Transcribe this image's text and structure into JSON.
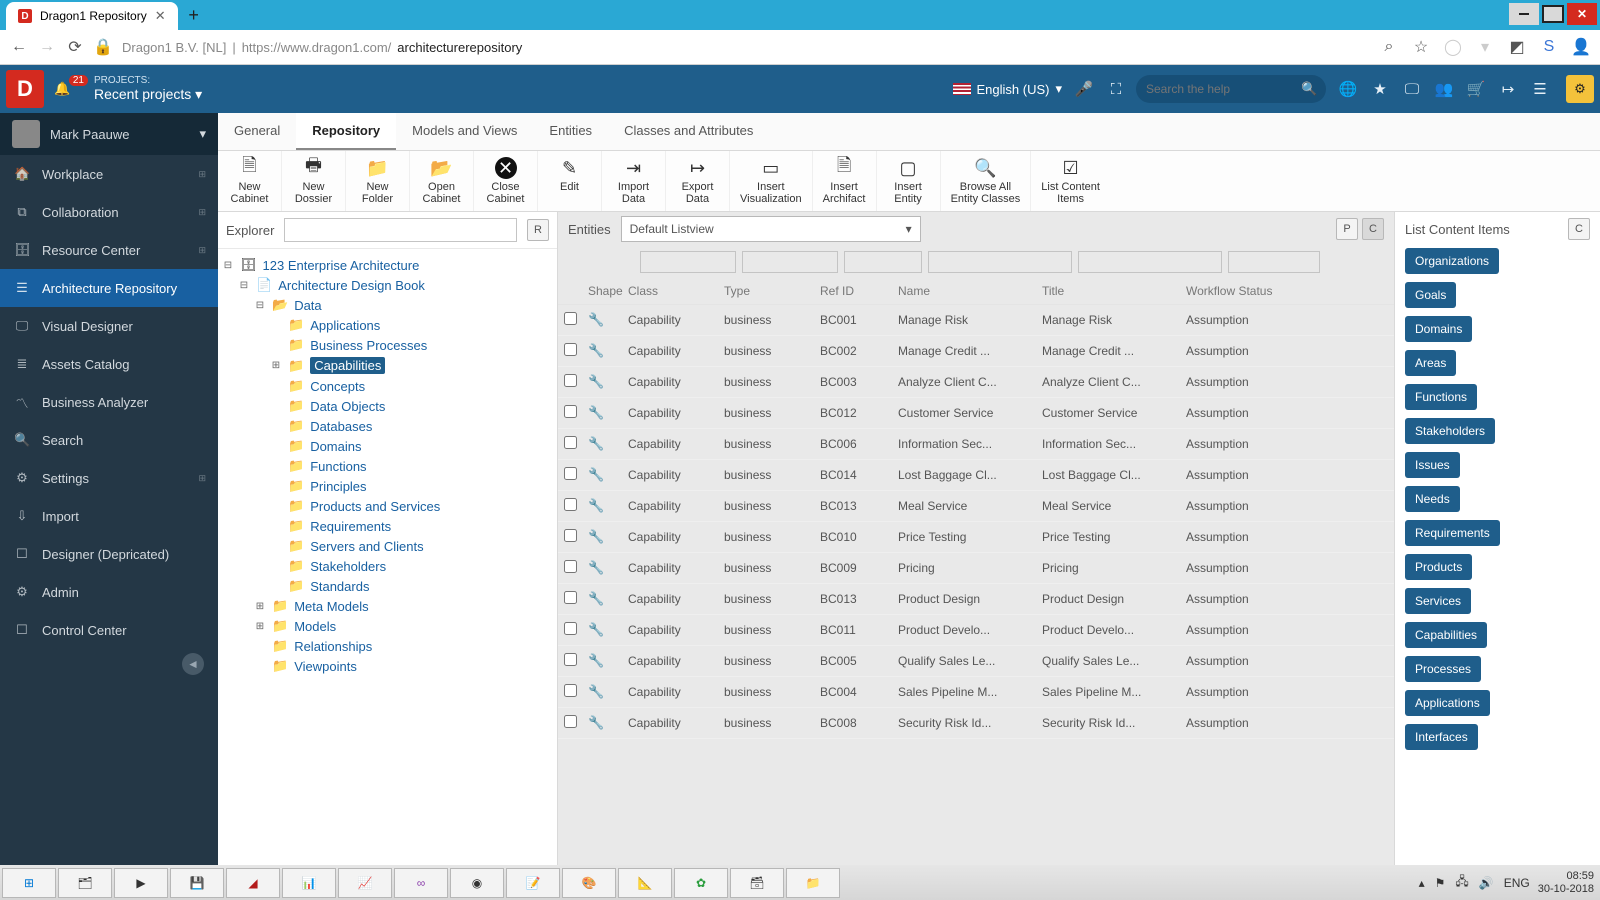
{
  "browser": {
    "tab_title": "Dragon1 Repository",
    "identity": "Dragon1 B.V. [NL]",
    "url_host": "https://www.dragon1.com/",
    "url_path": "architecturerepository"
  },
  "header": {
    "projects_label": "PROJECTS:",
    "projects_name": "Recent projects",
    "badge": "21",
    "language": "English (US)",
    "search_placeholder": "Search the help"
  },
  "user": {
    "name": "Mark Paauwe"
  },
  "leftnav": {
    "items": [
      {
        "label": "Workplace",
        "icon": "🏠",
        "plus": true
      },
      {
        "label": "Collaboration",
        "icon": "⧉",
        "plus": true
      },
      {
        "label": "Resource Center",
        "icon": "🗄",
        "plus": true
      },
      {
        "label": "Architecture Repository",
        "icon": "☰",
        "active": true
      },
      {
        "label": "Visual Designer",
        "icon": "🖵"
      },
      {
        "label": "Assets Catalog",
        "icon": "≣"
      },
      {
        "label": "Business Analyzer",
        "icon": "〽"
      },
      {
        "label": "Search",
        "icon": "🔍"
      },
      {
        "label": "Settings",
        "icon": "⚙",
        "plus": true
      },
      {
        "label": "Import",
        "icon": "⇩"
      },
      {
        "label": "Designer (Depricated)",
        "icon": "☐"
      },
      {
        "label": "Admin",
        "icon": "⚙"
      },
      {
        "label": "Control Center",
        "icon": "☐"
      }
    ]
  },
  "tabs": [
    "General",
    "Repository",
    "Models and Views",
    "Entities",
    "Classes and Attributes"
  ],
  "ribbon": [
    {
      "label": "New Cabinet",
      "icon": "🗎"
    },
    {
      "label": "New Dossier",
      "icon": "🖶"
    },
    {
      "label": "New Folder",
      "icon": "📁"
    },
    {
      "label": "Open Cabinet",
      "icon": "📂"
    },
    {
      "label": "Close Cabinet",
      "icon": "✕",
      "black": true
    },
    {
      "label": "Edit",
      "icon": "✎"
    },
    {
      "label": "Import Data",
      "icon": "⇥"
    },
    {
      "label": "Export Data",
      "icon": "↦"
    },
    {
      "label": "Insert Visualization",
      "icon": "▭"
    },
    {
      "label": "Insert Archifact",
      "icon": "🗎"
    },
    {
      "label": "Insert Entity",
      "icon": "▢"
    },
    {
      "label": "Browse All Entity Classes",
      "icon": "🔍"
    },
    {
      "label": "List Content Items",
      "icon": "☑"
    }
  ],
  "explorer": {
    "title": "Explorer"
  },
  "tree": {
    "root": "123 Enterprise Architecture",
    "book": "Architecture Design Book",
    "data": "Data",
    "data_children": [
      "Applications",
      "Business Processes",
      "Capabilities",
      "Concepts",
      "Data Objects",
      "Databases",
      "Domains",
      "Functions",
      "Principles",
      "Products and Services",
      "Requirements",
      "Servers and Clients",
      "Stakeholders",
      "Standards"
    ],
    "siblings": [
      "Meta Models",
      "Models",
      "Relationships",
      "Viewpoints"
    ]
  },
  "entities": {
    "title": "Entities",
    "listview": "Default Listview",
    "cols": [
      "Shape",
      "Class",
      "Type",
      "Ref ID",
      "Name",
      "Title",
      "Workflow Status"
    ],
    "rows": [
      {
        "class": "Capability",
        "type": "business",
        "ref": "BC001",
        "name": "Manage Risk",
        "title": "Manage Risk",
        "wf": "Assumption"
      },
      {
        "class": "Capability",
        "type": "business",
        "ref": "BC002",
        "name": "Manage Credit ...",
        "title": "Manage Credit ...",
        "wf": "Assumption"
      },
      {
        "class": "Capability",
        "type": "business",
        "ref": "BC003",
        "name": "Analyze Client C...",
        "title": "Analyze Client C...",
        "wf": "Assumption"
      },
      {
        "class": "Capability",
        "type": "business",
        "ref": "BC012",
        "name": "Customer Service",
        "title": "Customer Service",
        "wf": "Assumption"
      },
      {
        "class": "Capability",
        "type": "business",
        "ref": "BC006",
        "name": "Information Sec...",
        "title": "Information Sec...",
        "wf": "Assumption"
      },
      {
        "class": "Capability",
        "type": "business",
        "ref": "BC014",
        "name": "Lost Baggage Cl...",
        "title": "Lost Baggage Cl...",
        "wf": "Assumption"
      },
      {
        "class": "Capability",
        "type": "business",
        "ref": "BC013",
        "name": "Meal Service",
        "title": "Meal Service",
        "wf": "Assumption"
      },
      {
        "class": "Capability",
        "type": "business",
        "ref": "BC010",
        "name": "Price Testing",
        "title": "Price Testing",
        "wf": "Assumption"
      },
      {
        "class": "Capability",
        "type": "business",
        "ref": "BC009",
        "name": "Pricing",
        "title": "Pricing",
        "wf": "Assumption"
      },
      {
        "class": "Capability",
        "type": "business",
        "ref": "BC013",
        "name": "Product Design",
        "title": "Product Design",
        "wf": "Assumption"
      },
      {
        "class": "Capability",
        "type": "business",
        "ref": "BC011",
        "name": "Product Develo...",
        "title": "Product Develo...",
        "wf": "Assumption"
      },
      {
        "class": "Capability",
        "type": "business",
        "ref": "BC005",
        "name": "Qualify Sales Le...",
        "title": "Qualify Sales Le...",
        "wf": "Assumption"
      },
      {
        "class": "Capability",
        "type": "business",
        "ref": "BC004",
        "name": "Sales Pipeline M...",
        "title": "Sales Pipeline M...",
        "wf": "Assumption"
      },
      {
        "class": "Capability",
        "type": "business",
        "ref": "BC008",
        "name": "Security Risk Id...",
        "title": "Security Risk Id...",
        "wf": "Assumption"
      }
    ]
  },
  "right": {
    "title": "List Content Items",
    "chips": [
      "Organizations",
      "Goals",
      "Domains",
      "Areas",
      "Functions",
      "Stakeholders",
      "Issues",
      "Needs",
      "Requirements",
      "Products",
      "Services",
      "Capabilities",
      "Processes",
      "Applications",
      "Interfaces"
    ]
  },
  "taskbar": {
    "lang": "ENG",
    "time": "08:59",
    "date": "30-10-2018"
  }
}
